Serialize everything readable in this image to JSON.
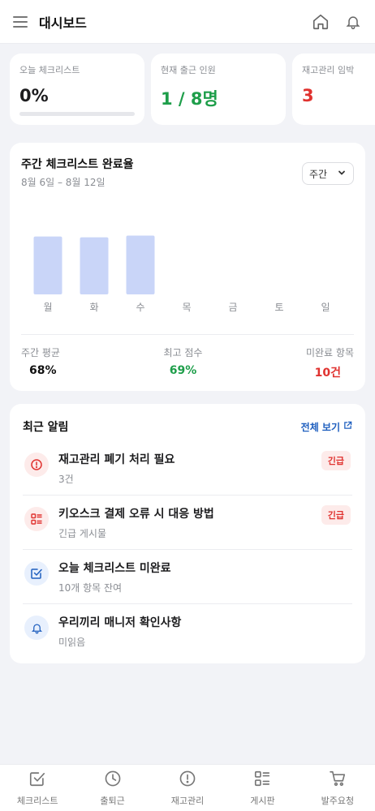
{
  "header": {
    "title": "대시보드",
    "icons": [
      "menu-icon",
      "home-icon",
      "bell-icon"
    ]
  },
  "stats": [
    {
      "label": "오늘 체크리스트",
      "value": "0%",
      "progress": 0
    },
    {
      "label": "현재 출근 인원",
      "value": "1 / 8명"
    },
    {
      "label": "재고관리 임박",
      "value": "3"
    }
  ],
  "weekly": {
    "title": "주간 체크리스트 완료율",
    "range": "8월 6일 – 8월 12일",
    "period_select": "주간",
    "summary": [
      {
        "label": "주간 평균",
        "value": "68%"
      },
      {
        "label": "최고 점수",
        "value": "69%"
      },
      {
        "label": "미완료 항목",
        "value": "10건"
      }
    ]
  },
  "chart_data": {
    "type": "bar",
    "categories": [
      "월",
      "화",
      "수",
      "목",
      "금",
      "토",
      "일"
    ],
    "values": [
      68,
      67,
      69,
      null,
      null,
      null,
      null
    ],
    "title": "주간 체크리스트 완료율",
    "ylim": [
      0,
      100
    ],
    "grid": false,
    "bar_color": "#c9d5f8"
  },
  "alerts": {
    "title": "최근 알림",
    "view_all": "전체 보기",
    "items": [
      {
        "title": "재고관리 폐기 처리 필요",
        "sub": "3건",
        "badge": "긴급",
        "icon": "alert-circle-icon",
        "tone": "red"
      },
      {
        "title": "키오스크 결제 오류 시 대응 방법",
        "sub": "긴급 게시물",
        "badge": "긴급",
        "icon": "board-icon",
        "tone": "red"
      },
      {
        "title": "오늘 체크리스트 미완료",
        "sub": "10개 항목 잔여",
        "badge": "",
        "icon": "checkbox-icon",
        "tone": "blue"
      },
      {
        "title": "우리끼리 매니저 확인사항",
        "sub": "미읽음",
        "badge": "",
        "icon": "bell-icon",
        "tone": "blue"
      }
    ]
  },
  "tabs": [
    {
      "label": "체크리스트",
      "icon": "checkbox-icon"
    },
    {
      "label": "출퇴근",
      "icon": "clock-icon"
    },
    {
      "label": "재고관리",
      "icon": "alert-circle-icon"
    },
    {
      "label": "게시판",
      "icon": "board-icon"
    },
    {
      "label": "발주요청",
      "icon": "cart-icon"
    }
  ],
  "colors": {
    "accent_blue": "#1f5fbf",
    "green": "#1e9e4a",
    "red": "#e0322f",
    "bar": "#c9d5f8"
  }
}
